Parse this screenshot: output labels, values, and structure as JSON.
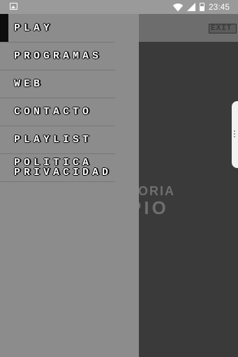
{
  "status_bar": {
    "time": "23:45"
  },
  "app_bar": {
    "exit_label": "EXIT"
  },
  "background": {
    "title_line1": "LORIA",
    "title_line2": "PIO"
  },
  "drawer": {
    "items": [
      {
        "label": "PLAY"
      },
      {
        "label": "PROGRAMAS"
      },
      {
        "label": "WEB"
      },
      {
        "label": "CONTACTO"
      },
      {
        "label": "PLAYLIST"
      },
      {
        "label_line1": "POLITICA",
        "label_line2": "PRIVACIDAD"
      }
    ]
  },
  "colors": {
    "drawer_bg": "#8c8c8c",
    "app_bg": "#3a3a3a",
    "active_indicator": "#0d0d0d",
    "label_fill": "#fafafa"
  }
}
